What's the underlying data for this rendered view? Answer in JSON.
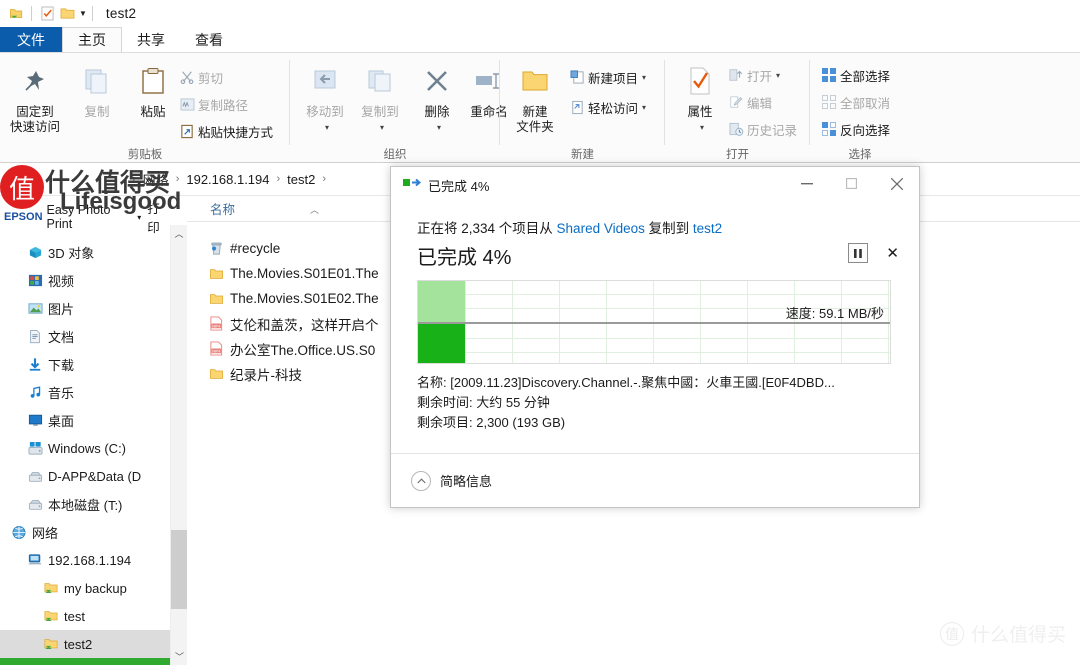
{
  "window": {
    "title": "test2",
    "quick_access_icons": [
      "folder-network-icon",
      "checklist-icon",
      "folder-icon",
      "chevron-down-icon"
    ]
  },
  "ribbon": {
    "tabs": [
      {
        "label": "文件",
        "key": "file"
      },
      {
        "label": "主页",
        "key": "home"
      },
      {
        "label": "共享",
        "key": "share"
      },
      {
        "label": "查看",
        "key": "view"
      }
    ],
    "groups": [
      {
        "name": "剪贴板",
        "big": [
          {
            "label_l1": "固定到",
            "label_l2": "快速访问",
            "icon": "pin-icon",
            "dim": false
          },
          {
            "label_l1": "复制",
            "label_l2": "",
            "icon": "copy-icon",
            "dim": true
          },
          {
            "label_l1": "粘贴",
            "label_l2": "",
            "icon": "paste-icon",
            "dim": false
          }
        ],
        "small": [
          {
            "label": "剪切",
            "icon": "scissors-icon",
            "dim": true
          },
          {
            "label": "复制路径",
            "icon": "copy-path-icon",
            "dim": true
          },
          {
            "label": "粘贴快捷方式",
            "icon": "paste-shortcut-icon",
            "dim": false
          }
        ]
      },
      {
        "name": "组织",
        "big": [
          {
            "label_l1": "移动到",
            "label_l2": "",
            "icon": "move-to-icon",
            "dim": true,
            "caret": true
          },
          {
            "label_l1": "复制到",
            "label_l2": "",
            "icon": "copy-to-icon",
            "dim": true,
            "caret": true
          },
          {
            "label_l1": "删除",
            "label_l2": "",
            "icon": "delete-icon",
            "dim": false,
            "caret": true
          },
          {
            "label_l1": "重命名",
            "label_l2": "",
            "icon": "rename-icon",
            "dim": false,
            "caret": false
          }
        ],
        "small": []
      },
      {
        "name": "新建",
        "big": [
          {
            "label_l1": "新建",
            "label_l2": "文件夹",
            "icon": "new-folder-icon",
            "dim": false
          }
        ],
        "small": [
          {
            "label": "新建项目",
            "icon": "new-item-icon",
            "dim": false,
            "caret": true
          },
          {
            "label": "轻松访问",
            "icon": "easy-access-icon",
            "dim": false,
            "caret": true
          }
        ]
      },
      {
        "name": "打开",
        "big": [
          {
            "label_l1": "属性",
            "label_l2": "",
            "icon": "properties-icon",
            "dim": false,
            "caret": true
          }
        ],
        "small": [
          {
            "label": "打开",
            "icon": "open-icon",
            "dim": true,
            "caret": true
          },
          {
            "label": "编辑",
            "icon": "edit-icon",
            "dim": true
          },
          {
            "label": "历史记录",
            "icon": "history-icon",
            "dim": true
          }
        ]
      },
      {
        "name": "选择",
        "big": [],
        "small": [
          {
            "label": "全部选择",
            "icon": "select-all-icon",
            "dim": false
          },
          {
            "label": "全部取消",
            "icon": "select-none-icon",
            "dim": true
          },
          {
            "label": "反向选择",
            "icon": "invert-selection-icon",
            "dim": false
          }
        ]
      }
    ]
  },
  "address_bar": {
    "crumbs": [
      "网络",
      "192.168.1.194",
      "test2"
    ],
    "separator": "›"
  },
  "nav": {
    "header": {
      "label": "Easy Photo Print",
      "brand": "EPSON",
      "trailing": "打印"
    },
    "items": [
      {
        "label": "3D 对象",
        "icon": "3d-objects-icon",
        "indent": 1,
        "selected": false
      },
      {
        "label": "视频",
        "icon": "videos-icon",
        "indent": 1,
        "selected": false
      },
      {
        "label": "图片",
        "icon": "pictures-icon",
        "indent": 1,
        "selected": false
      },
      {
        "label": "文档",
        "icon": "documents-icon",
        "indent": 1,
        "selected": false
      },
      {
        "label": "下载",
        "icon": "downloads-icon",
        "indent": 1,
        "selected": false
      },
      {
        "label": "音乐",
        "icon": "music-icon",
        "indent": 1,
        "selected": false
      },
      {
        "label": "桌面",
        "icon": "desktop-icon",
        "indent": 1,
        "selected": false
      },
      {
        "label": "Windows (C:)",
        "icon": "windows-drive-icon",
        "indent": 1,
        "selected": false
      },
      {
        "label": "D-APP&Data (D",
        "icon": "drive-icon",
        "indent": 1,
        "selected": false
      },
      {
        "label": "本地磁盘 (T:)",
        "icon": "drive-icon",
        "indent": 1,
        "selected": false
      },
      {
        "label": "网络",
        "icon": "network-icon",
        "indent": 0,
        "selected": false
      },
      {
        "label": "192.168.1.194",
        "icon": "computer-icon",
        "indent": 1,
        "selected": false
      },
      {
        "label": "my backup",
        "icon": "shared-folder-icon",
        "indent": 2,
        "selected": false
      },
      {
        "label": "test",
        "icon": "shared-folder-icon",
        "indent": 2,
        "selected": false
      },
      {
        "label": "test2",
        "icon": "shared-folder-icon",
        "indent": 2,
        "selected": true
      }
    ]
  },
  "file_list": {
    "column_header": "名称",
    "sort_indicator": "chevron-up-icon",
    "items": [
      {
        "name": "#recycle",
        "icon": "recycle-bin-icon"
      },
      {
        "name": "The.Movies.S01E01.The",
        "icon": "folder-icon"
      },
      {
        "name": "The.Movies.S01E02.The",
        "icon": "folder-icon"
      },
      {
        "name": "艾伦和盖茨，这样开启个",
        "icon": "mp4-file-icon"
      },
      {
        "name": "办公室The.Office.US.S0",
        "icon": "mp4-file-icon"
      },
      {
        "name": "纪录片-科技",
        "icon": "folder-icon"
      }
    ]
  },
  "dialog": {
    "title": "已完成 4%",
    "title_icon": "copy-progress-icon",
    "window_buttons": [
      {
        "name": "minimize",
        "glyph": "—"
      },
      {
        "name": "maximize",
        "glyph": "▢"
      },
      {
        "name": "close",
        "glyph": "✕"
      }
    ],
    "line1_pre": "正在将 2,334 个项目从 ",
    "line1_src": "Shared Videos",
    "line1_mid": " 复制到 ",
    "line1_dst": "test2",
    "percent_label": "已完成 4%",
    "percent_value": 4,
    "pause_button": "pause-icon",
    "cancel_button": "✕",
    "speed_label": "速度: 59.1 MB/秒",
    "details": [
      "名称: [2009.11.23]Discovery.Channel.-.聚焦中國：火車王國.[E0F4DBD...",
      "剩余时间: 大约 55 分钟",
      "剩余项目: 2,300 (193 GB)"
    ],
    "footer_label": "简略信息",
    "footer_icon": "chevron-up-circle-icon",
    "colors": {
      "progress_light": "#a4e39b",
      "progress_dark": "#18b118",
      "link": "#0a6cc4"
    }
  },
  "watermarks": {
    "top_left": {
      "badge": "值",
      "line1": "什么值得买",
      "line2": "Lifeisgood"
    },
    "bottom_right": {
      "badge": "值",
      "text": "什么值得买"
    }
  }
}
